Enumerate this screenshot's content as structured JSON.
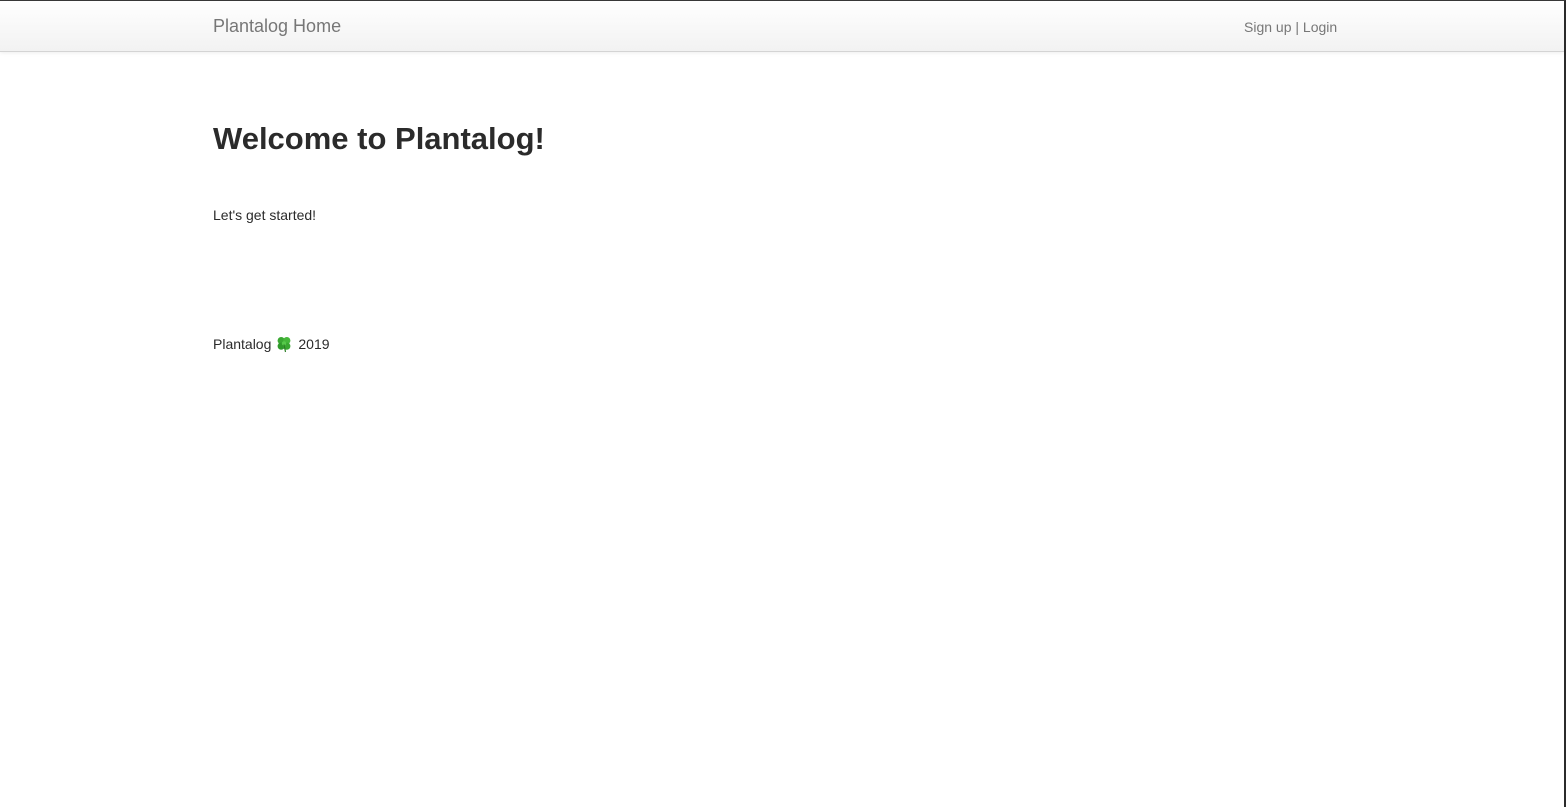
{
  "navbar": {
    "brand": "Plantalog Home",
    "signup_label": "Sign up",
    "separator": "|",
    "login_label": "Login"
  },
  "main": {
    "heading": "Welcome to Plantalog!",
    "intro": "Let's get started!"
  },
  "footer": {
    "name": "Plantalog",
    "icon": "four-leaf-clover-icon",
    "year": "2019"
  },
  "colors": {
    "nav_text": "#777777",
    "body_text": "#2b2b2b",
    "clover_green": "#3aa832"
  }
}
